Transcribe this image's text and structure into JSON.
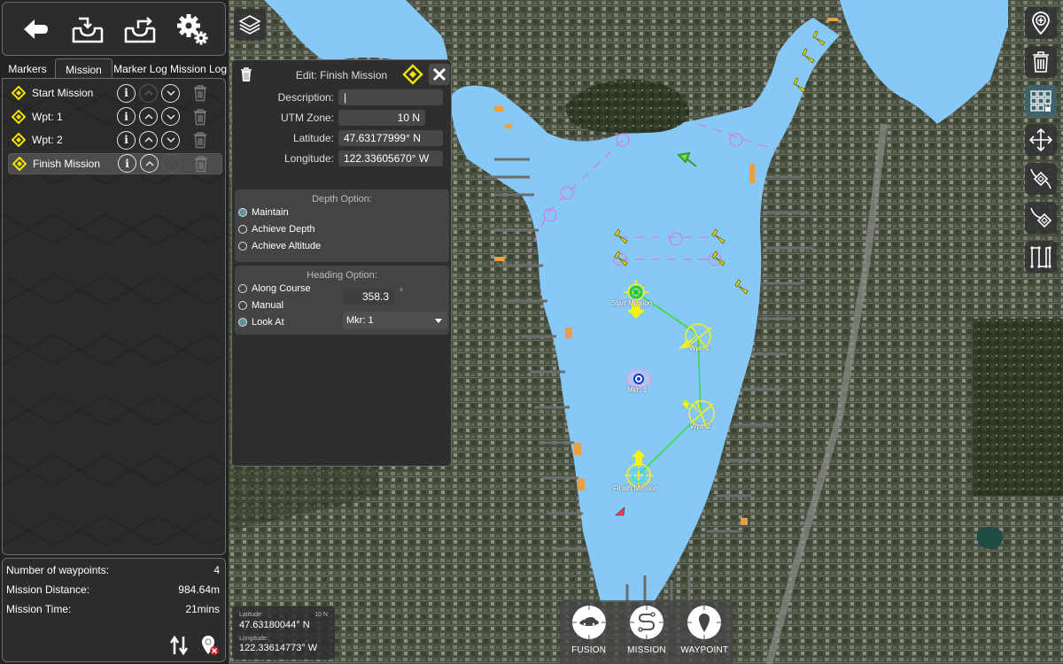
{
  "toolbar": {
    "buttons": [
      {
        "name": "back-button",
        "icon": "arrow-left-icon"
      },
      {
        "name": "import-button",
        "icon": "tray-import-icon"
      },
      {
        "name": "export-button",
        "icon": "tray-export-icon"
      },
      {
        "name": "settings-button",
        "icon": "gears-icon"
      }
    ]
  },
  "tabs": [
    {
      "label": "Markers",
      "active": false
    },
    {
      "label": "Mission",
      "active": true
    },
    {
      "label": "Marker Log",
      "active": false
    },
    {
      "label": "Mission Log",
      "active": false
    }
  ],
  "mission_items": [
    {
      "label": "Start Mission",
      "up_enabled": false,
      "down_enabled": true,
      "selected": false
    },
    {
      "label": "Wpt: 1",
      "up_enabled": true,
      "down_enabled": true,
      "selected": false
    },
    {
      "label": "Wpt: 2",
      "up_enabled": true,
      "down_enabled": true,
      "selected": false
    },
    {
      "label": "Finish Mission",
      "up_enabled": true,
      "down_enabled": false,
      "selected": true
    }
  ],
  "summary": {
    "waypoints_label": "Number of waypoints:",
    "waypoints_value": "4",
    "distance_label": "Mission Distance:",
    "distance_value": "984.64m",
    "time_label": "Mission Time:",
    "time_value": "21mins"
  },
  "edit_dialog": {
    "title": "Edit: Finish Mission",
    "description_label": "Description:",
    "description_value": "|",
    "utm_label": "UTM Zone:",
    "utm_value": "10 N",
    "latitude_label": "Latitude:",
    "latitude_value": "47.63177999° N",
    "longitude_label": "Longitude:",
    "longitude_value": "122.33605670° W",
    "depth_title": "Depth Option:",
    "depth_options": [
      {
        "label": "Maintain",
        "selected": true
      },
      {
        "label": "Achieve Depth",
        "selected": false
      },
      {
        "label": "Achieve Altitude",
        "selected": false
      }
    ],
    "heading_title": "Heading Option:",
    "heading_options": [
      {
        "label": "Along Course",
        "selected": false
      },
      {
        "label": "Manual",
        "selected": false
      },
      {
        "label": "Look At",
        "selected": true
      }
    ],
    "heading_value": "358.3",
    "heading_unit": "°",
    "look_at_selected": "Mkr: 1"
  },
  "coords_readout": {
    "latitude_label": "Latitude:",
    "zone": "10 N",
    "latitude_value": "47.63180044° N",
    "longitude_label": "Longitude:",
    "longitude_value": "122.33614773° W"
  },
  "modes": [
    {
      "label": "FUSION",
      "icon": "fusion-vehicle-icon"
    },
    {
      "label": "MISSION",
      "icon": "mission-path-icon"
    },
    {
      "label": "WAYPOINT",
      "icon": "waypoint-pin-icon"
    }
  ],
  "map_tools": [
    {
      "name": "add-marker-button",
      "icon": "map-pin-plus-icon",
      "active": false
    },
    {
      "name": "delete-button",
      "icon": "trash-icon",
      "active": false
    },
    {
      "name": "grid-lock-button",
      "icon": "grid-lock-icon",
      "active": true
    },
    {
      "name": "pan-button",
      "icon": "move-arrows-icon",
      "active": false
    },
    {
      "name": "route-waypoint-button",
      "icon": "route-diamond-icon",
      "active": false
    },
    {
      "name": "route-end-button",
      "icon": "route-end-diamond-icon",
      "active": false
    },
    {
      "name": "lawnmower-button",
      "icon": "lawnmower-pattern-icon",
      "active": false
    }
  ],
  "map_labels": {
    "start": "Start Mission",
    "wpt1": "Wpt: 1",
    "wpt2": "Wpt: 2",
    "finish": "Finish Mission",
    "marker": "Mkr: 1"
  },
  "colors": {
    "water": "#86c8f6",
    "route": "#33dd33",
    "waypoint": "#f2f21a",
    "marker_blue": "#1a33cc",
    "accent_diamond": "#f2e600",
    "selected_radio": "#5f8fa0"
  }
}
